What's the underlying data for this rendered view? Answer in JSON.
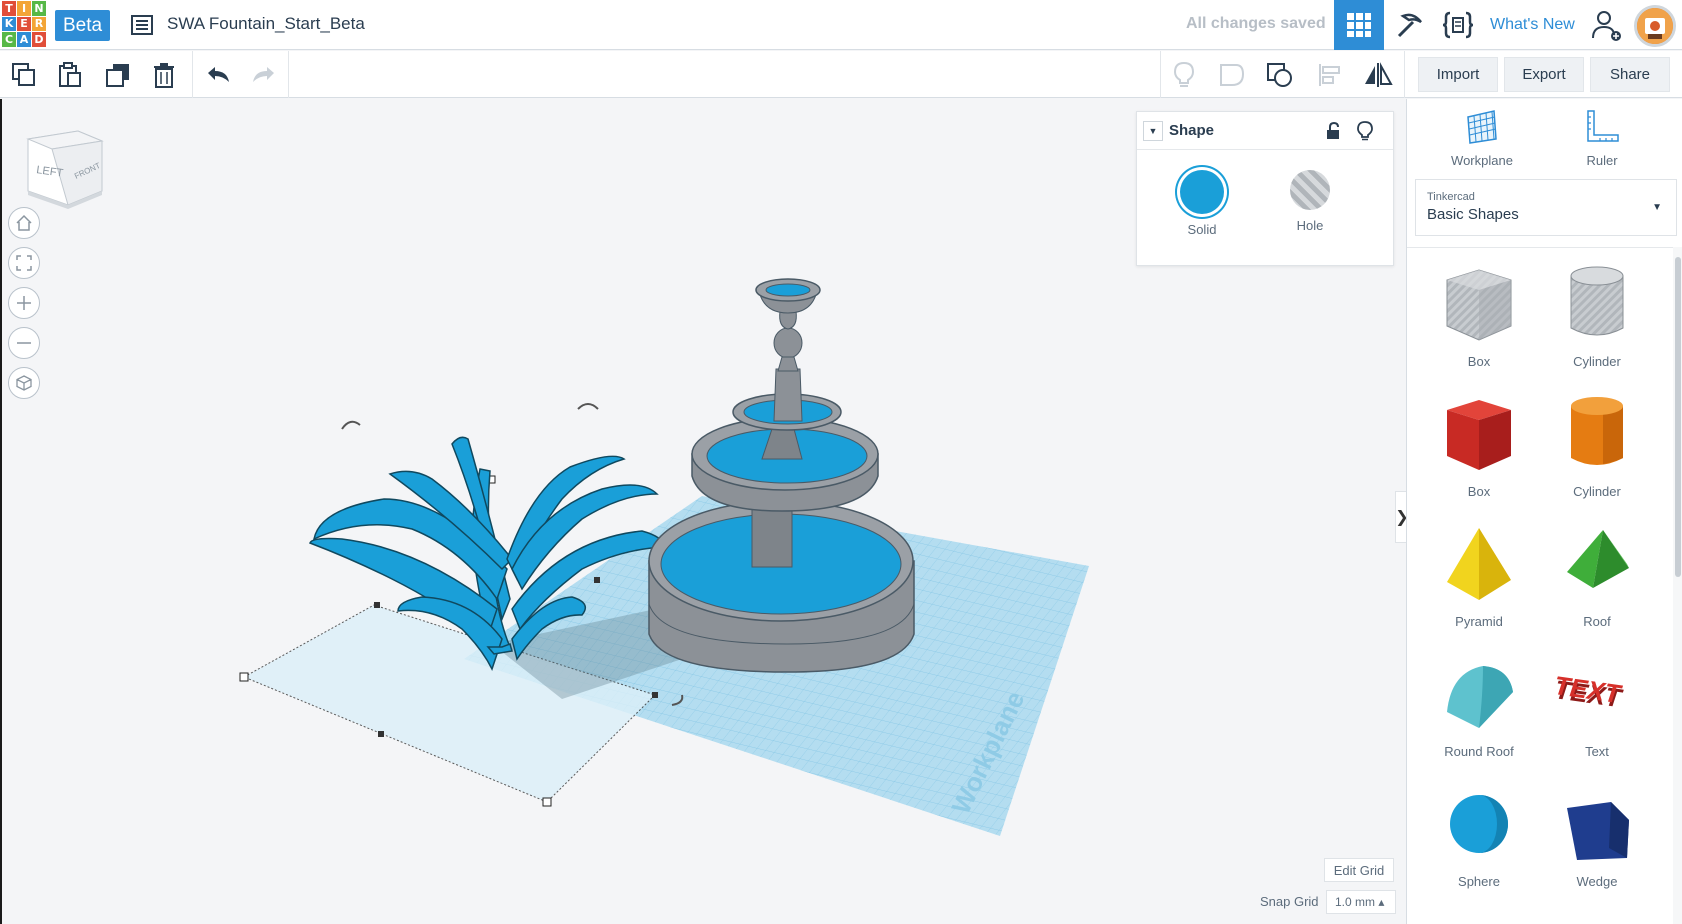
{
  "app": {
    "logo_letters": [
      "T",
      "I",
      "N",
      "K",
      "E",
      "R",
      "C",
      "A",
      "D"
    ],
    "beta_label": "Beta",
    "document_title": "SWA Fountain_Start_Beta",
    "save_status": "All changes saved",
    "whats_new_label": "What's New"
  },
  "toolbar": {
    "import_label": "Import",
    "export_label": "Export",
    "share_label": "Share"
  },
  "workspace": {
    "view_cube_faces": [
      "LEFT",
      "FRONT"
    ],
    "workplane_label": "Workplane",
    "edit_grid_label": "Edit Grid",
    "snap_grid_label": "Snap Grid",
    "snap_grid_value": "1.0 mm ▴"
  },
  "shape_panel": {
    "title": "Shape",
    "solid_label": "Solid",
    "hole_label": "Hole"
  },
  "sidebar": {
    "workplane_label": "Workplane",
    "ruler_label": "Ruler",
    "library_provider": "Tinkercad",
    "library_name": "Basic Shapes",
    "shapes": [
      {
        "label": "Box"
      },
      {
        "label": "Cylinder"
      },
      {
        "label": "Box"
      },
      {
        "label": "Cylinder"
      },
      {
        "label": "Pyramid"
      },
      {
        "label": "Roof"
      },
      {
        "label": "Round Roof"
      },
      {
        "label": "Text"
      },
      {
        "label": "Sphere"
      },
      {
        "label": "Wedge"
      }
    ]
  },
  "colors": {
    "accent": "#2e8dd6",
    "model_blue": "#1a9fd8",
    "solid_blue": "#1a9fd8",
    "workplane": "#a8d8ee"
  }
}
